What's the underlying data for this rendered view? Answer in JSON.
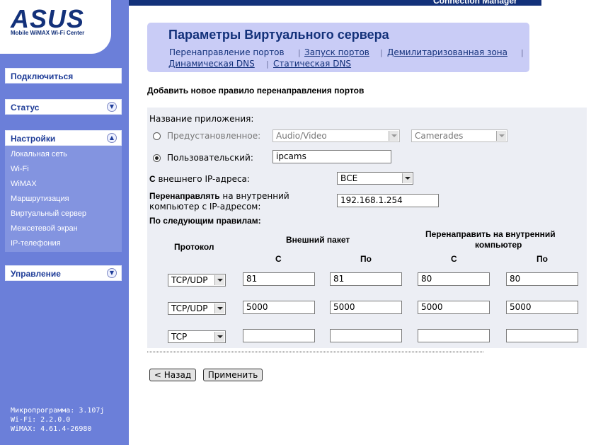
{
  "brand": {
    "logo": "ASUS",
    "subtitle": "Mobile WiMAX Wi-Fi Center",
    "app_title": "Connection Manager"
  },
  "sidebar": {
    "connect": "Подключиться",
    "status": "Статус",
    "settings": "Настройки",
    "settings_items": [
      "Локальная сеть",
      "Wi-Fi",
      "WiMAX",
      "Маршрутизация",
      "Виртуальный сервер",
      "Межсетевой экран",
      "IP-телефония"
    ],
    "management": "Управление",
    "firmware": "Микропрограмма: 3.107j",
    "wifi": "Wi-Fi: 2.2.0.0",
    "wimax": "WiMAX: 4.61.4-26980"
  },
  "header": {
    "title": "Параметры Виртуального сервера",
    "links": [
      "Перенаправление портов",
      "Запуск портов",
      "Демилитаризованная зона",
      "Динамическая DNS",
      "Статическая DNS"
    ]
  },
  "section_title": "Добавить новое правило перенаправления портов",
  "form": {
    "app_name_label": "Название приложения:",
    "preset_label": "Предустановленное:",
    "preset_category": "Audio/Video",
    "preset_app": "Camerades",
    "custom_label": "Пользовательский:",
    "custom_value": "ipcams",
    "external_ip_label": "С внешнего IP-адреса:",
    "external_ip_value": "ВСЕ",
    "redirect_label_bold": "Перенаправлять",
    "redirect_label_rest": " на внутренний",
    "redirect_label_line2": "компьютер с IP-адресом:",
    "internal_ip": "192.168.1.254",
    "rules_label": "По следующим правилам:",
    "col_protocol": "Протокол",
    "col_external": "Внешний пакет",
    "col_internal_1": "Перенаправить на внутренний",
    "col_internal_2": "компьютер",
    "col_from": "С",
    "col_to": "По",
    "rows": [
      {
        "protocol": "TCP/UDP",
        "ext_from": "81",
        "ext_to": "81",
        "int_from": "80",
        "int_to": "80"
      },
      {
        "protocol": "TCP/UDP",
        "ext_from": "5000",
        "ext_to": "5000",
        "int_from": "5000",
        "int_to": "5000"
      },
      {
        "protocol": "TCP",
        "ext_from": "",
        "ext_to": "",
        "int_from": "",
        "int_to": ""
      }
    ]
  },
  "buttons": {
    "back": "< Назад",
    "apply": "Применить"
  }
}
